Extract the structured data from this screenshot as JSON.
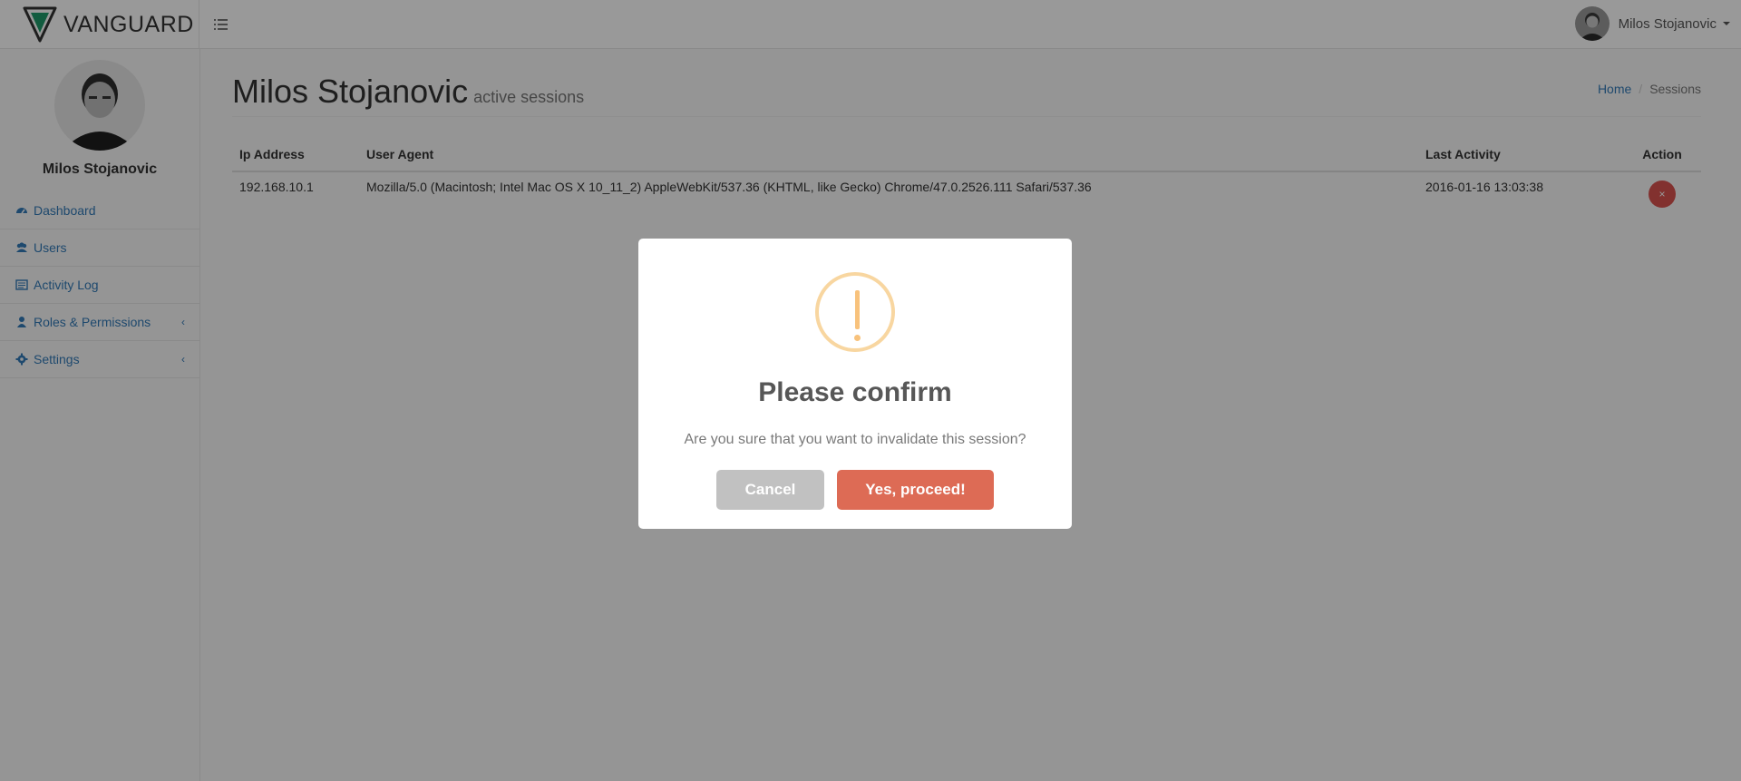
{
  "brand": {
    "name": "VANGUARD"
  },
  "topbar": {
    "user_name": "Milos Stojanovic"
  },
  "sidebar": {
    "profile_name": "Milos Stojanovic",
    "items": [
      {
        "label": "Dashboard",
        "icon": "dashboard-icon"
      },
      {
        "label": "Users",
        "icon": "users-icon"
      },
      {
        "label": "Activity Log",
        "icon": "list-icon"
      },
      {
        "label": "Roles & Permissions",
        "icon": "user-icon",
        "arrow": "‹"
      },
      {
        "label": "Settings",
        "icon": "gear-icon",
        "arrow": "‹"
      }
    ]
  },
  "page": {
    "title": "Milos Stojanovic",
    "subtitle": "active sessions",
    "breadcrumb": {
      "home": "Home",
      "separator": "/",
      "current": "Sessions"
    }
  },
  "table": {
    "headers": {
      "ip": "Ip Address",
      "agent": "User Agent",
      "last": "Last Activity",
      "action": "Action"
    },
    "rows": [
      {
        "ip": "192.168.10.1",
        "agent": "Mozilla/5.0 (Macintosh; Intel Mac OS X 10_11_2) AppleWebKit/537.36 (KHTML, like Gecko) Chrome/47.0.2526.111 Safari/537.36",
        "last": "2016-01-16 13:03:38",
        "action_icon": "×"
      }
    ]
  },
  "modal": {
    "title": "Please confirm",
    "text": "Are you sure that you want to invalidate this session?",
    "cancel_label": "Cancel",
    "confirm_label": "Yes, proceed!"
  },
  "colors": {
    "link": "#337ab7",
    "danger": "#d9534f",
    "confirm": "#dd6b55",
    "cancel": "#c1c1c1",
    "warning": "#f8c27c"
  }
}
